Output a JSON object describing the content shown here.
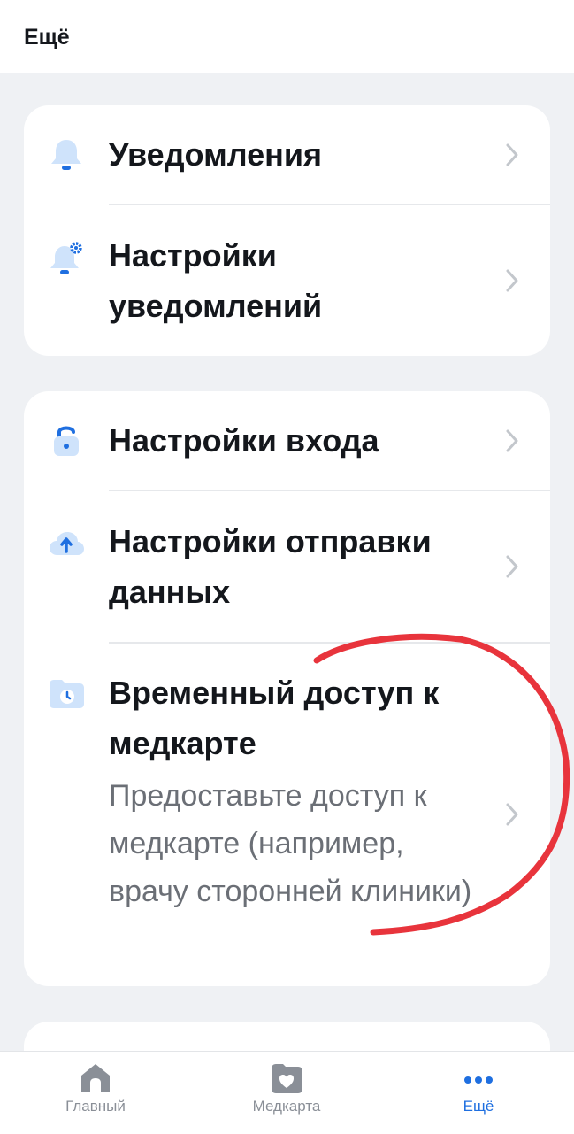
{
  "header": {
    "title": "Ещё"
  },
  "groups": [
    {
      "items": [
        {
          "title": "Уведомления",
          "icon": "bell-icon"
        },
        {
          "title": "Настройки уведомлений",
          "icon": "bell-settings-icon"
        }
      ]
    },
    {
      "items": [
        {
          "title": "Настройки входа",
          "icon": "lock-icon"
        },
        {
          "title": "Настройки отправки данных",
          "icon": "cloud-upload-icon"
        },
        {
          "title": "Временный доступ к медкарте",
          "subtitle": "Предоставьте доступ к медкарте (например, врачу сторонней клиники)",
          "icon": "folder-clock-icon"
        }
      ]
    }
  ],
  "tabbar": {
    "tabs": [
      {
        "label": "Главный",
        "icon": "home-icon",
        "active": false
      },
      {
        "label": "Медкарта",
        "icon": "medcard-heart-icon",
        "active": false
      },
      {
        "label": "Ещё",
        "icon": "more-dots-icon",
        "active": true
      }
    ]
  },
  "colors": {
    "accent": "#1f6fe0",
    "icon_fill": "#cfe3fb",
    "annotation": "#e8343c",
    "background": "#eff1f4"
  }
}
